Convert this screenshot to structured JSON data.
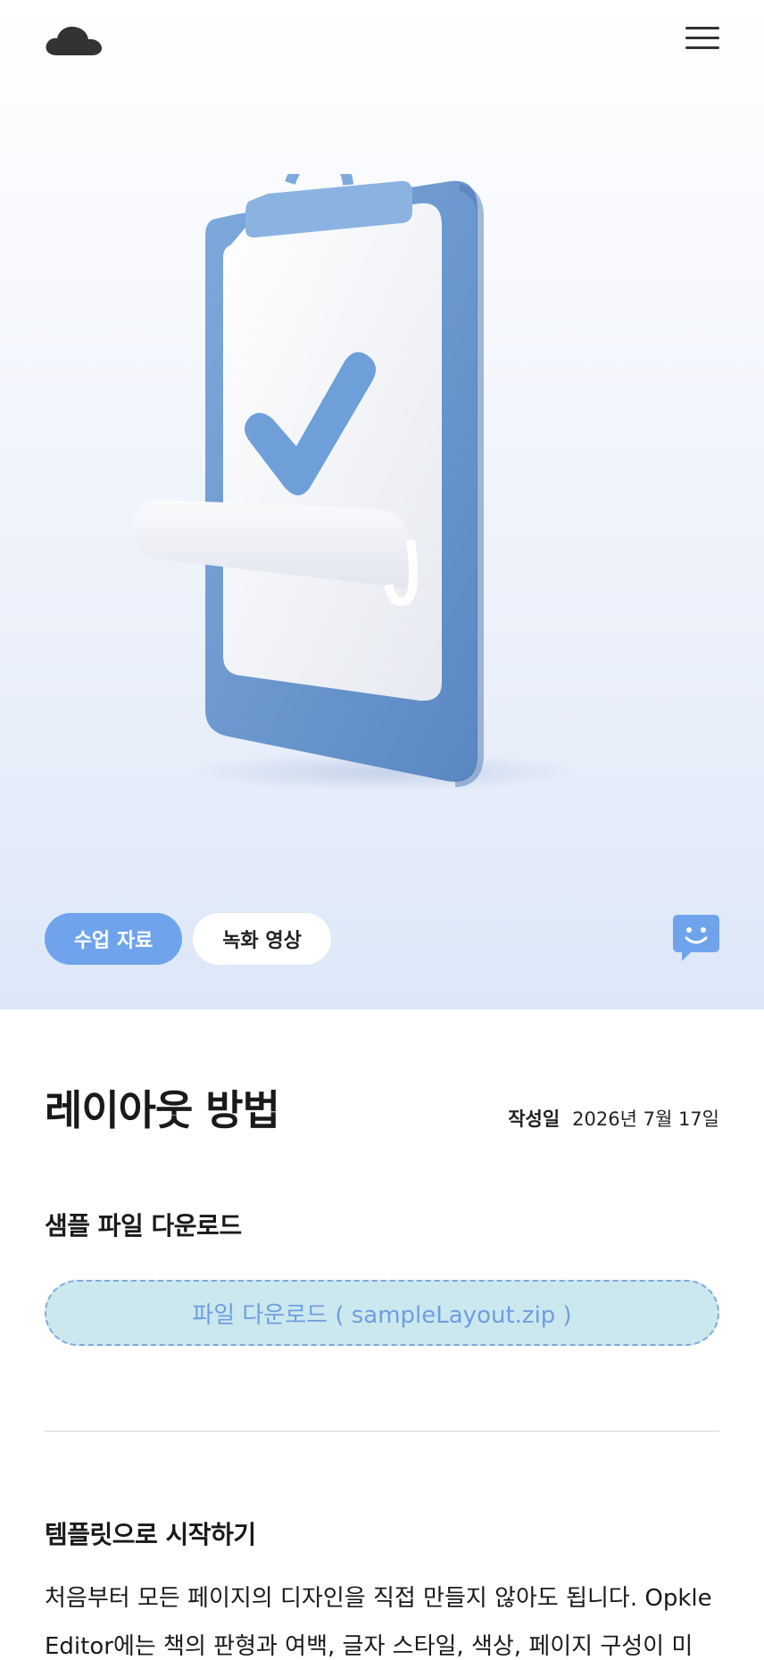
{
  "header": {
    "logo_icon": "cloud-icon",
    "menu_icon": "hamburger-menu-icon"
  },
  "hero": {
    "illustration": "clipboard-checkmark-illustration",
    "tags": [
      {
        "label": "수업 자료",
        "active": true
      },
      {
        "label": "녹화 영상",
        "active": false
      }
    ],
    "chat_icon": "smiley-chat-icon"
  },
  "article": {
    "title": "레이아웃 방법",
    "date_label": "작성일",
    "date_value": "2026년 7월 17일"
  },
  "download_section": {
    "title": "샘플 파일 다운로드",
    "button_label": "파일 다운로드 ( sampleLayout.zip )"
  },
  "template_section": {
    "title": "템플릿으로 시작하기",
    "body": "처음부터 모든 페이지의 디자인을 직접 만들지 않아도 됩니다. Opkle Editor에는 책의 판형과 여백, 글자 스타일, 색상, 페이지 구성이 미"
  },
  "colors": {
    "accent": "#6fa4ec",
    "download_bg": "#cce8ef",
    "download_text": "#6e9ee0",
    "clipboard_blue": "#6b98d0"
  }
}
